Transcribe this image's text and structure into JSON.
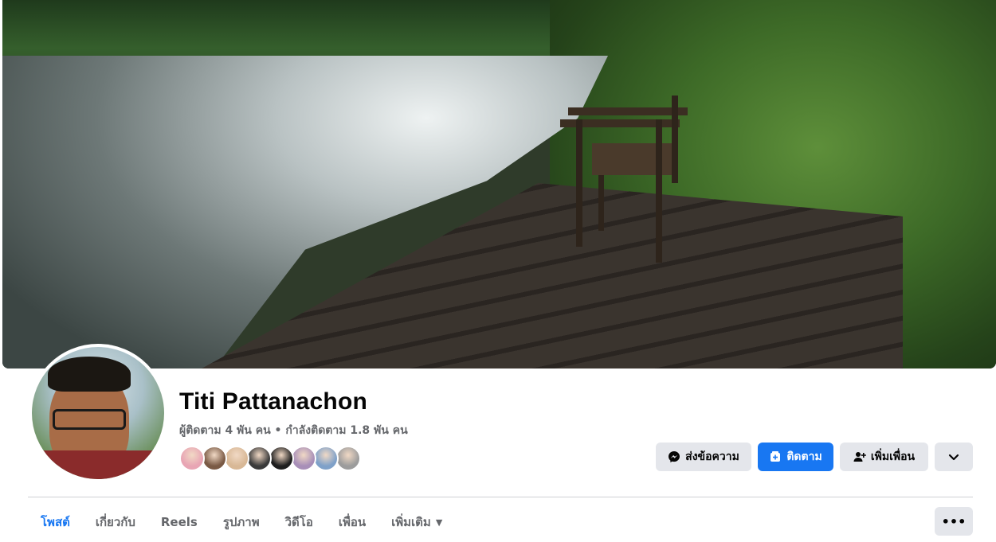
{
  "profile": {
    "name": "Titi Pattanachon",
    "followers_text": "ผู้ติดตาม 4 พัน คน • กำลังติดตาม 1.8 พัน คน"
  },
  "friend_avatars": [
    {
      "color": "#e8a5b4"
    },
    {
      "color": "#7a5a45"
    },
    {
      "color": "#d8b896"
    },
    {
      "color": "#3a3a3a"
    },
    {
      "color": "#1e1e1e"
    },
    {
      "color": "#a88fb8"
    },
    {
      "color": "#7fa1c9"
    },
    {
      "color": "#9c9c9c"
    }
  ],
  "actions": {
    "message_label": "ส่งข้อความ",
    "follow_label": "ติดตาม",
    "add_friend_label": "เพิ่มเพื่อน"
  },
  "tabs": [
    {
      "label": "โพสต์",
      "active": true
    },
    {
      "label": "เกี่ยวกับ",
      "active": false
    },
    {
      "label": "Reels",
      "active": false
    },
    {
      "label": "รูปภาพ",
      "active": false
    },
    {
      "label": "วิดีโอ",
      "active": false
    },
    {
      "label": "เพื่อน",
      "active": false
    },
    {
      "label": "เพิ่มเติม",
      "active": false
    }
  ],
  "colors": {
    "accent": "#1877f2",
    "secondary_button": "#e4e6eb",
    "muted_text": "#65676b"
  },
  "icons": {
    "message": "messenger-icon",
    "follow": "follow-icon",
    "add_friend": "add-friend-icon",
    "dropdown": "chevron-down-icon",
    "more": "more-dots-icon"
  }
}
